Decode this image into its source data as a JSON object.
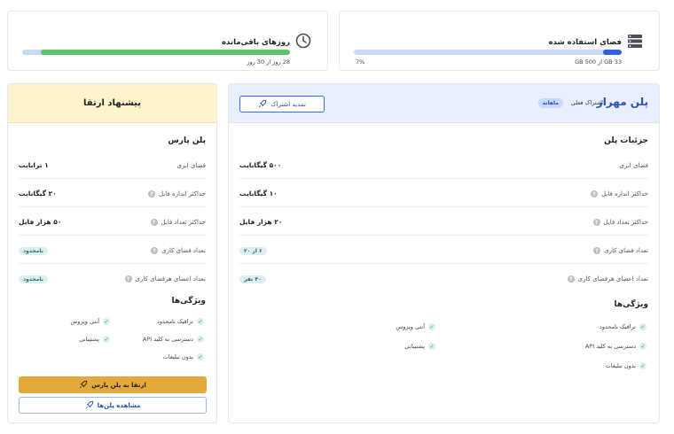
{
  "stats": {
    "storage": {
      "title": "فضای استفاده شده",
      "used_text": "33 GB از 500 GB",
      "percent_text": "7%",
      "progress_percent": 7,
      "fill_color": "#2f5fe0"
    },
    "days": {
      "title": "روزهای باقی‌مانده",
      "remaining_text": "28 روز از 30 روز",
      "progress_percent": 93,
      "fill_color": "#5cc46a"
    }
  },
  "current_plan": {
    "name": "پلن مهراز",
    "subtitle": "اشتراک فعلی",
    "badge": "ماهانه",
    "renew_label": "تمدید اشتراک",
    "details_title": "جزئیات پلن",
    "rows": [
      {
        "label": "فضای ابری",
        "value": "۵۰۰ گیگابایت",
        "help": false,
        "pill": false
      },
      {
        "label": "حداکثر اندازه فایل",
        "value": "۱۰ گیگابایت",
        "help": true,
        "pill": false
      },
      {
        "label": "حداکثر تعداد فایل",
        "value": "۲۰ هزار فایل",
        "help": true,
        "pill": false
      },
      {
        "label": "تعداد فضای کاری",
        "value": "۶ از ۲۰",
        "help": true,
        "pill": true
      },
      {
        "label": "تعداد اعضای هرفضای کاری",
        "value": "۴۰ نفر",
        "help": true,
        "pill": true
      }
    ],
    "features_title": "ویژگی‌ها",
    "features": [
      "ترافیک نامحدود",
      "آنتی ویروس",
      "دسترسی به کلید API",
      "پشتیبانی",
      "بدون تبلیغات"
    ]
  },
  "upgrade": {
    "header": "پیشنهاد ارتقا",
    "plan_name": "پلن پارس",
    "rows": [
      {
        "label": "فضای ابری",
        "value": "۱ ترابایت",
        "help": false,
        "pill": false
      },
      {
        "label": "حداکثر اندازه فایل",
        "value": "۲۰ گیگابایت",
        "help": true,
        "pill": false
      },
      {
        "label": "حداکثر تعداد فایل",
        "value": "۵۰ هزار فایل",
        "help": true,
        "pill": false
      },
      {
        "label": "تعداد فضای کاری",
        "value": "نامحدود",
        "help": true,
        "pill": true
      },
      {
        "label": "تعداد اعضای هرفضای کاری",
        "value": "نامحدود",
        "help": true,
        "pill": true
      }
    ],
    "features_title": "ویژگی‌ها",
    "features": [
      "ترافیک نامحدود",
      "آنتی ویروس",
      "دسترسی به کلید API",
      "پشتیبانی",
      "بدون تبلیغات"
    ],
    "upgrade_button": "ارتقا به پلن پارس",
    "view_plans_button": "مشاهده پلن‌ها"
  },
  "icons": {
    "storage": "server-stack-icon",
    "days": "clock-icon",
    "rocket": "rocket-icon",
    "help": "question-icon",
    "check": "check-icon"
  },
  "colors": {
    "accent": "#2c4fb4",
    "plan_header_bg": "#e8f0ff",
    "upgrade_header_bg": "#fdf3cd",
    "upgrade_button": "#e4a93a",
    "pill_bg": "#dcefef"
  }
}
